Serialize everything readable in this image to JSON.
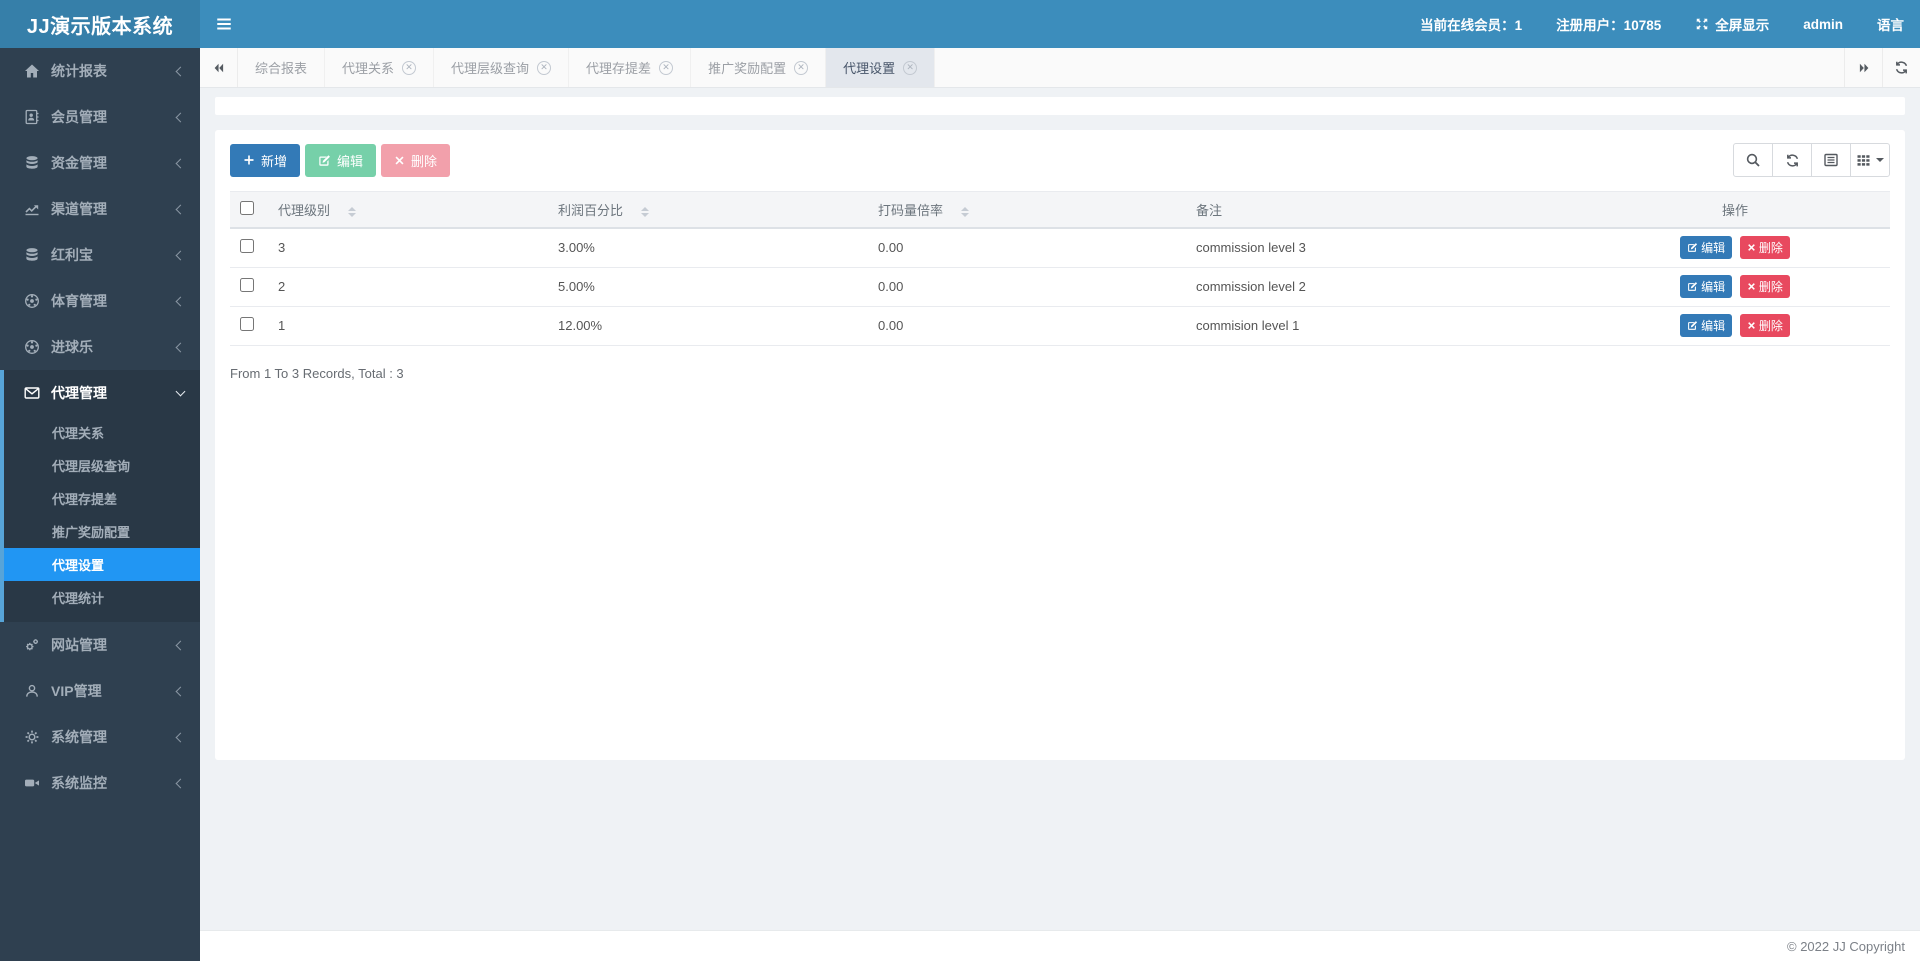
{
  "header": {
    "brand": "JJ演示版本系统",
    "online_members": "当前在线会员：1",
    "registered_users": "注册用户：10785",
    "fullscreen_label": "全屏显示",
    "username": "admin",
    "language_label": "语言"
  },
  "sidebar": {
    "items": [
      {
        "label": "统计报表",
        "icon": "home-icon"
      },
      {
        "label": "会员管理",
        "icon": "address-book-icon"
      },
      {
        "label": "资金管理",
        "icon": "database-icon"
      },
      {
        "label": "渠道管理",
        "icon": "line-chart-icon"
      },
      {
        "label": "红利宝",
        "icon": "database-icon"
      },
      {
        "label": "体育管理",
        "icon": "soccer-icon"
      },
      {
        "label": "进球乐",
        "icon": "soccer-icon"
      },
      {
        "label": "代理管理",
        "icon": "envelope-icon",
        "expanded": true,
        "children": [
          "代理关系",
          "代理层级查询",
          "代理存提差",
          "推广奖励配置",
          "代理设置",
          "代理统计"
        ],
        "active_child": "代理设置"
      },
      {
        "label": "网站管理",
        "icon": "cogs-icon"
      },
      {
        "label": "VIP管理",
        "icon": "user-icon"
      },
      {
        "label": "系统管理",
        "icon": "gear-icon"
      },
      {
        "label": "系统监控",
        "icon": "video-camera-icon"
      }
    ]
  },
  "tabbar": {
    "tabs": [
      {
        "label": "综合报表",
        "closable": false,
        "active": false
      },
      {
        "label": "代理关系",
        "closable": true,
        "active": false
      },
      {
        "label": "代理层级查询",
        "closable": true,
        "active": false
      },
      {
        "label": "代理存提差",
        "closable": true,
        "active": false
      },
      {
        "label": "推广奖励配置",
        "closable": true,
        "active": false
      },
      {
        "label": "代理设置",
        "closable": true,
        "active": true
      }
    ]
  },
  "toolbar": {
    "add_label": "新增",
    "edit_label": "编辑",
    "delete_label": "删除"
  },
  "table": {
    "columns": [
      "代理级别",
      "利润百分比",
      "打码量倍率",
      "备注",
      "操作"
    ],
    "sortable_columns": [
      "代理级别",
      "利润百分比",
      "打码量倍率"
    ],
    "rows": [
      {
        "agent_level": "3",
        "profit_percent": "3.00%",
        "bet_multiplier": "0.00",
        "remark": "commission level 3"
      },
      {
        "agent_level": "2",
        "profit_percent": "5.00%",
        "bet_multiplier": "0.00",
        "remark": "commission level 2"
      },
      {
        "agent_level": "1",
        "profit_percent": "12.00%",
        "bet_multiplier": "0.00",
        "remark": "commision level 1"
      }
    ],
    "row_actions": {
      "edit_label": "编辑",
      "delete_label": "删除"
    },
    "summary": "From 1 To 3 Records, Total : 3"
  },
  "footer": {
    "copyright": "© 2022 JJ Copyright"
  },
  "colors": {
    "topbar": "#3c8dbc",
    "topbar_brand": "#367fa9",
    "sidebar": "#2f4050",
    "sidebar_submenu": "#293846",
    "submenu_accent": "#57a4d8",
    "active_menu_item": "#2196f3",
    "active_tab_bg": "#e3e7ed",
    "primary_button": "#337ab7",
    "edit_button_muted": "#76d0a9",
    "delete_button_muted": "#f2a0ab",
    "row_delete_button": "#e8495f"
  }
}
